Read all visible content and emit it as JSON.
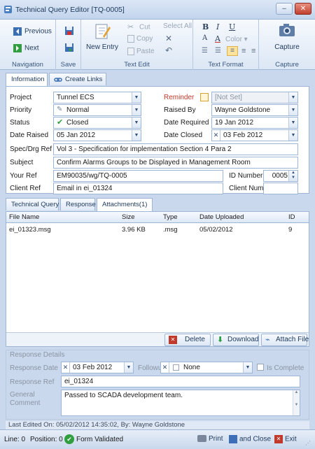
{
  "window": {
    "title": "Technical Query Editor [TQ-0005]"
  },
  "ribbon": {
    "navigation": {
      "previous": "Previous",
      "next": "Next",
      "group": "Navigation"
    },
    "save": {
      "group": "Save"
    },
    "text_edit": {
      "new_entry": "New Entry",
      "cut": "Cut",
      "copy": "Copy",
      "paste": "Paste",
      "select_all": "Select All",
      "group": "Text Edit"
    },
    "text_format": {
      "color": "Color",
      "group": "Text Format"
    },
    "capture": {
      "label": "Capture",
      "group": "Capture"
    }
  },
  "tabs": {
    "information": "Information",
    "create_links": "Create Links"
  },
  "info": {
    "project_label": "Project",
    "project": "Tunnel ECS",
    "priority_label": "Priority",
    "priority": "Normal",
    "status_label": "Status",
    "status": "Closed",
    "date_raised_label": "Date Raised",
    "date_raised": "05 Jan 2012",
    "reminder_label": "Reminder",
    "reminder": "[Not Set]",
    "raised_by_label": "Raised By",
    "raised_by": "Wayne Goldstone",
    "date_required_label": "Date Required",
    "date_required": "19 Jan 2012",
    "date_closed_label": "Date Closed",
    "date_closed": "03 Feb 2012",
    "spec_label": "Spec/Drg Ref",
    "spec": "Vol 3 - Specification for implementation Section 4 Para 2",
    "subject_label": "Subject",
    "subject": "Confirm Alarms Groups to be Displayed in Management Room",
    "your_ref_label": "Your Ref",
    "your_ref": "EM90035/wg/TQ-0005",
    "id_number_label": "ID Number",
    "id_number": "0005",
    "client_ref_label": "Client Ref",
    "client_ref": "Email in ei_01324",
    "client_num_label": "Client Num",
    "client_num": ""
  },
  "lower_tabs": {
    "technical_query": "Technical Query",
    "response": "Response",
    "attachments": "Attachments(1)"
  },
  "attachments": {
    "columns": [
      "File Name",
      "Size",
      "Type",
      "Date Uploaded",
      "ID"
    ],
    "rows": [
      [
        "ei_01323.msg",
        "3.96 KB",
        ".msg",
        "05/02/2012",
        "9"
      ]
    ],
    "delete": "Delete",
    "download": "Download",
    "attach": "Attach File"
  },
  "response": {
    "group": "Response Details",
    "date_label": "Response Date",
    "date": "03 Feb 2012",
    "followup_label": "Followup",
    "followup": "None",
    "complete_label": "Is Complete",
    "ref_label": "Response Ref",
    "ref": "ei_01324",
    "comment_label": "General Comment",
    "comment": "Passed to SCADA development team."
  },
  "footer": {
    "last_edited": "Last Edited On: 05/02/2012 14:35:02, By: Wayne Goldstone"
  },
  "status": {
    "line": "Line: 0",
    "position": "Position: 0",
    "validated": "Form Validated",
    "print": "Print",
    "and_close": "and Close",
    "exit": "Exit"
  },
  "colors": {
    "accent": "#1e395b",
    "frame": "#9eb6d6",
    "bg": "#c9d8ec",
    "danger": "#c0392b",
    "ok": "#2e9e3e"
  }
}
